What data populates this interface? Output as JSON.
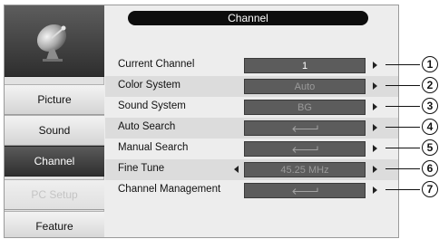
{
  "menu": {
    "title": "Channel"
  },
  "sidebar": {
    "items": [
      {
        "label": "Picture",
        "state": "normal"
      },
      {
        "label": "Sound",
        "state": "normal"
      },
      {
        "label": "Channel",
        "state": "active"
      },
      {
        "label": "PC Setup",
        "state": "disabled"
      },
      {
        "label": "Feature",
        "state": "normal"
      }
    ]
  },
  "rows": [
    {
      "label": "Current Channel",
      "value": "1",
      "left_arrow": false,
      "right_arrow": true,
      "callout": "1"
    },
    {
      "label": "Color System",
      "value": "Auto",
      "left_arrow": false,
      "right_arrow": true,
      "callout": "2"
    },
    {
      "label": "Sound System",
      "value": "BG",
      "left_arrow": false,
      "right_arrow": true,
      "callout": "3"
    },
    {
      "label": "Auto Search",
      "value": "",
      "icon": "enter-arrow-icon",
      "left_arrow": false,
      "right_arrow": true,
      "callout": "4"
    },
    {
      "label": "Manual Search",
      "value": "",
      "icon": "enter-arrow-icon",
      "left_arrow": false,
      "right_arrow": true,
      "callout": "5"
    },
    {
      "label": "Fine Tune",
      "value": "45.25 MHz",
      "left_arrow": true,
      "right_arrow": true,
      "callout": "6"
    },
    {
      "label": "Channel Management",
      "value": "",
      "icon": "enter-arrow-icon",
      "left_arrow": false,
      "right_arrow": true,
      "callout": "7"
    }
  ],
  "colors": {
    "active_tab": "#3a3a3a",
    "value_box": "#5c5c5c",
    "title_pill": "#0d0d0d"
  },
  "icons": {
    "logo": "satellite-dish-icon"
  }
}
